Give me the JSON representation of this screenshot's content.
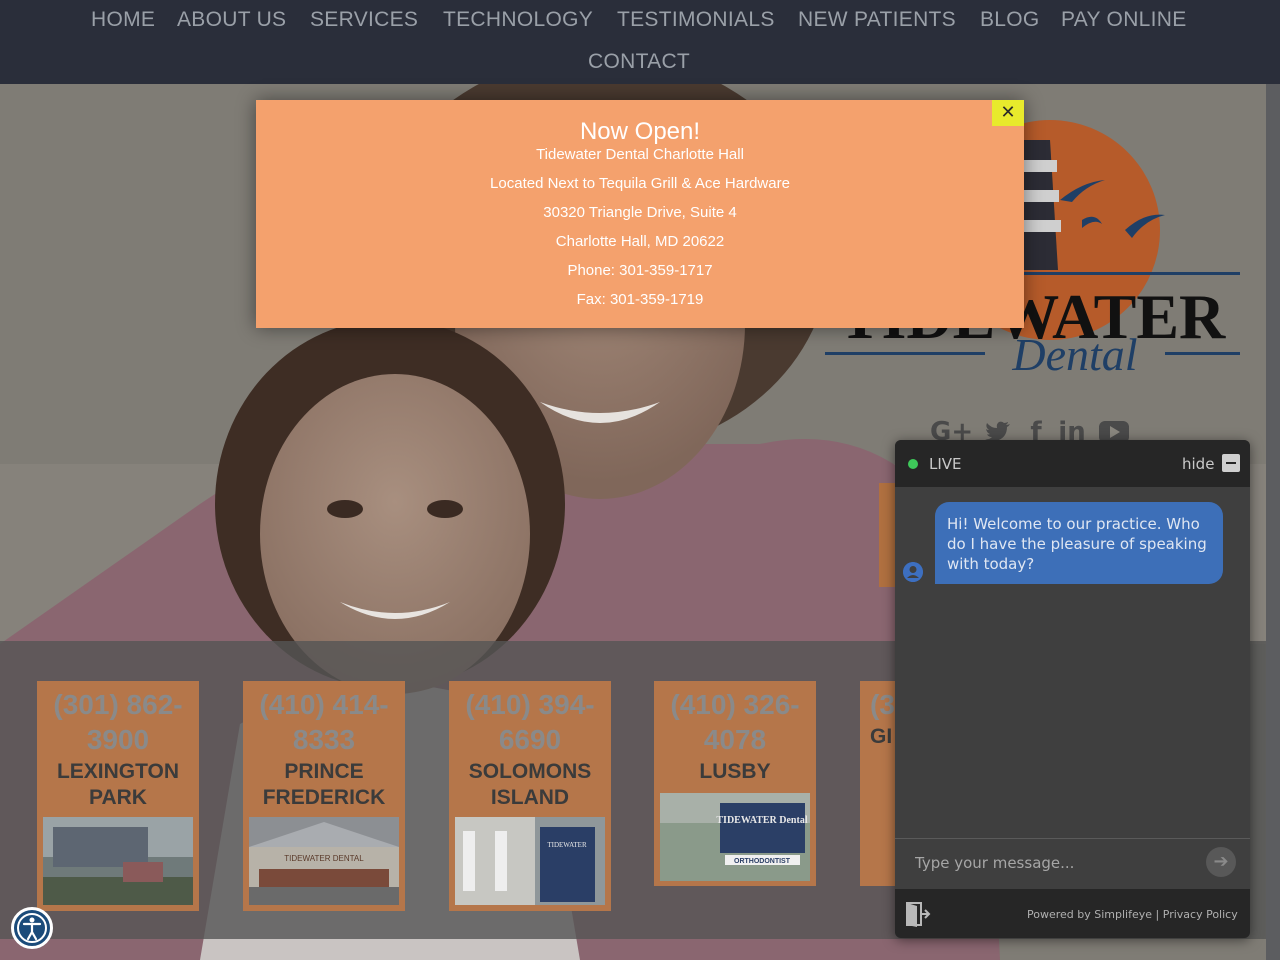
{
  "nav": {
    "items": [
      "HOME",
      "ABOUT US",
      "SERVICES",
      "TECHNOLOGY",
      "TESTIMONIALS",
      "NEW PATIENTS",
      "BLOG",
      "PAY ONLINE",
      "CONTACT"
    ]
  },
  "logo": {
    "line1": "TIDEWATER",
    "line2": "Dental"
  },
  "social": {
    "icons": [
      "google-plus-icon",
      "twitter-icon",
      "facebook-icon",
      "linkedin-icon",
      "youtube-icon"
    ],
    "glyphs": [
      "G+",
      "",
      "f",
      "in",
      ""
    ]
  },
  "popup": {
    "title": "Now Open!",
    "lines": [
      "Tidewater Dental Charlotte Hall",
      "Located Next to Tequila Grill & Ace Hardware",
      "30320 Triangle Drive, Suite 4",
      "Charlotte Hall, MD 20622",
      "Phone: 301-359-1717",
      "Fax: 301-359-1719"
    ],
    "close_glyph": "✕"
  },
  "locations": [
    {
      "phone": "(301) 862-3900",
      "name": "LEXINGTON PARK"
    },
    {
      "phone": "(410) 414-8333",
      "name": "PRINCE FREDERICK"
    },
    {
      "phone": "(410) 394-6690",
      "name": "SOLOMONS ISLAND"
    },
    {
      "phone": "(410) 326-4078",
      "name": "LUSBY"
    },
    {
      "phone": "(3",
      "name": "GI"
    }
  ],
  "location_photos": [
    {
      "sign": ""
    },
    {
      "sign": "TIDEWATER DENTAL"
    },
    {
      "sign": "TIDEWATER"
    },
    {
      "sign": "TIDEWATER Dental",
      "sub": "ORTHODONTIST"
    },
    {
      "sign": ""
    }
  ],
  "chat": {
    "status": "LIVE",
    "hide_label": "hide",
    "message": "Hi! Welcome to our practice.  Who do I have the pleasure of speaking with today?",
    "input_placeholder": "Type your message...",
    "send_glyph": "➔",
    "powered_by": "Powered by Simplifeye",
    "separator": "|",
    "privacy": "Privacy Policy"
  },
  "colors": {
    "nav_bg": "#2a2e3a",
    "popup_bg": "#f4a16d",
    "card_bg": "#b5764a",
    "chat_bubble": "#3d6fb8",
    "close_bg": "#e8ea2c"
  }
}
